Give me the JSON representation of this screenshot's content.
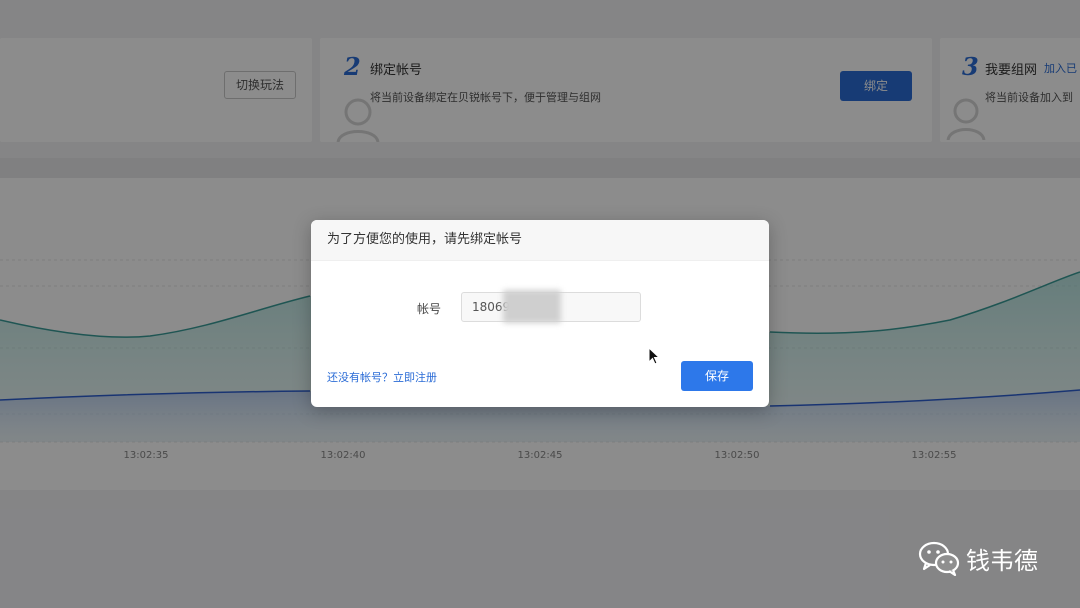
{
  "background": {
    "switch_button_label": "切换玩法",
    "step2": {
      "number": "2",
      "title": "绑定帐号",
      "description": "将当前设备绑定在贝锐帐号下，便于管理与组网",
      "button_label": "绑定"
    },
    "step3": {
      "number": "3",
      "title": "我要组网",
      "link_label": "加入已",
      "description": "将当前设备加入到"
    },
    "chart": {
      "time_ticks": [
        "13:02:35",
        "13:02:40",
        "13:02:45",
        "13:02:50",
        "13:02:55"
      ]
    }
  },
  "modal": {
    "title": "为了方便您的使用，请先绑定帐号",
    "account_label": "帐号",
    "account_value": "18069",
    "register_link": "还没有帐号？立即注册",
    "save_label": "保存"
  },
  "watermark": {
    "text": "钱韦德"
  },
  "colors": {
    "primary": "#2d78ea",
    "link": "#2b6cd6",
    "teal_line": "#3a9c97",
    "blue_line": "#2e5fd0"
  }
}
